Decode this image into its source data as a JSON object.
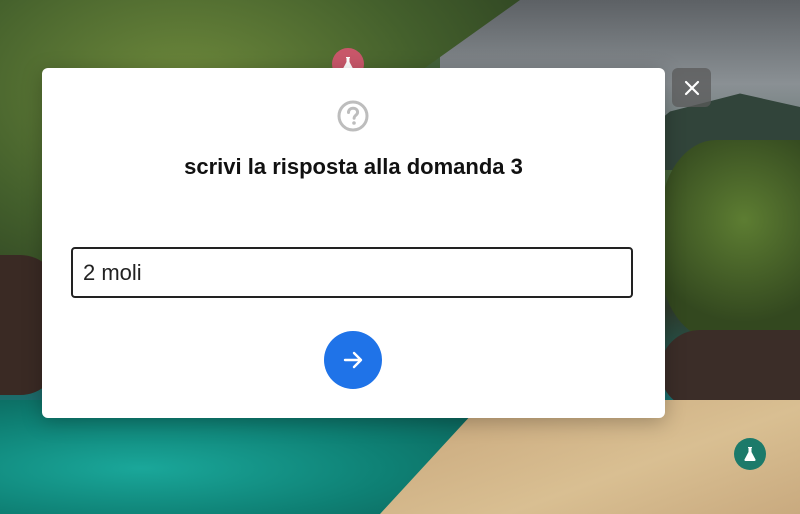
{
  "modal": {
    "icon": "question-circle-icon",
    "title": "scrivi la risposta alla domanda 3",
    "answer_value": "2 moli",
    "submit_icon": "arrow-right-icon",
    "accent_color": "#1f73e8"
  },
  "close_icon": "close-icon",
  "badges": [
    {
      "icon": "flask-icon",
      "color": "#c9576a"
    },
    {
      "icon": "flask-icon",
      "color": "#1c7a6a"
    }
  ]
}
